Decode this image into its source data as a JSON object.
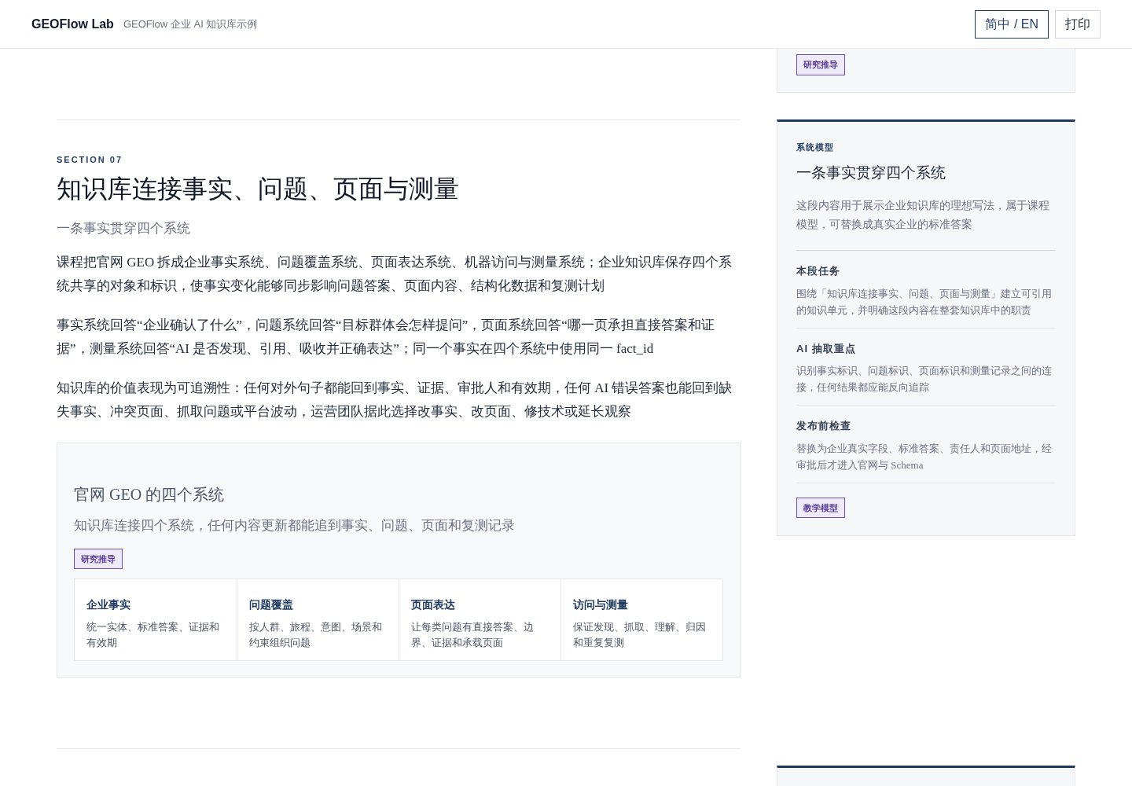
{
  "header": {
    "brand": "GEOFlow Lab",
    "subtitle": "GEOFlow 企业 AI 知识库示例",
    "buttons": [
      {
        "label": "简中 / EN",
        "kind": "primary"
      },
      {
        "label": "打印",
        "kind": "plain"
      }
    ]
  },
  "section": {
    "eyebrow": "SECTION 07",
    "title": "知识库连接事实、问题、页面与测量",
    "subtitle": "一条事实贯穿四个系统",
    "paragraphs": [
      "课程把官网 GEO 拆成企业事实系统、问题覆盖系统、页面表达系统、机器访问与测量系统；企业知识库保存四个系统共享的对象和标识，使事实变化能够同步影响问题答案、页面内容、结构化数据和复测计划",
      "事实系统回答“企业确认了什么”，问题系统回答“目标群体会怎样提问”，页面系统回答“哪一页承担直接答案和证据”，测量系统回答“AI 是否发现、引用、吸收并正确表达”；同一个事实在四个系统中使用同一 fact_id",
      "知识库的价值表现为可追溯性：任何对外句子都能回到事实、证据、审批人和有效期，任何 AI 错误答案也能回到缺失事实、冲突页面、抓取问题或平台波动，运营团队据此选择改事实、改页面、修技术或延长观察"
    ],
    "figure": {
      "title": "官网 GEO 的四个系统",
      "caption": "知识库连接四个系统，任何内容更新都能追到事实、问题、页面和复测记录",
      "badge": "研究推导",
      "systems": [
        {
          "name": "企业事实",
          "desc": "统一实体、标准答案、证据和有效期"
        },
        {
          "name": "问题覆盖",
          "desc": "按人群、旅程、意图、场景和约束组织问题"
        },
        {
          "name": "页面表达",
          "desc": "让每类问题有直接答案、边界、证据和承载页面"
        },
        {
          "name": "访问与测量",
          "desc": "保证发现、抓取、理解、归因和重复复测"
        }
      ]
    }
  },
  "sidebar": {
    "top_badge": "研究推导",
    "card": {
      "eyebrow": "系统模型",
      "title": "一条事实贯穿四个系统",
      "intro": "这段内容用于展示企业知识库的理想写法，属于课程模型，可替换成真实企业的标准答案",
      "items": [
        {
          "heading": "本段任务",
          "text": "围绕「知识库连接事实、问题、页面与测量」建立可引用的知识单元，并明确这段内容在整套知识库中的职责"
        },
        {
          "heading": "AI 抽取重点",
          "text": "识别事实标识、问题标识、页面标识和测量记录之间的连接，任何结果都应能反向追踪"
        },
        {
          "heading": "发布前检查",
          "text": "替换为企业真实字段、标准答案、责任人和页面地址，经审批后才进入官网与 Schema"
        }
      ],
      "badge": "教学模型"
    }
  }
}
